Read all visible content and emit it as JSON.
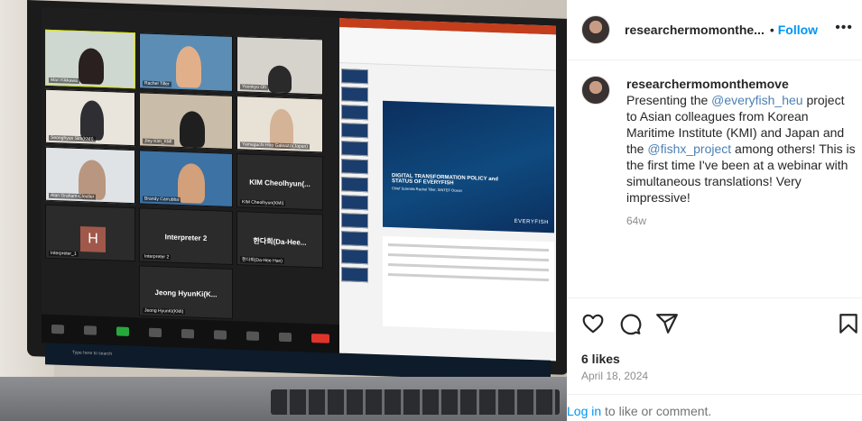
{
  "post": {
    "username": "researchermomonthe...",
    "follow_label": "Follow",
    "follow_separator": "•",
    "more_label": "•••"
  },
  "caption": {
    "username": "researchermomonthemove",
    "text_1": "Presenting the ",
    "mention_1": "@everyfish_heu",
    "text_2": " project to Asian colleagues from Korean Maritime Institute (KMI) and Japan and the ",
    "mention_2": "@fishx_project",
    "text_3": " among others! This is the first time I've been at a webinar with simultaneous translations! Very impressive!",
    "age": "64w"
  },
  "actions": {
    "like_icon": "heart-icon",
    "comment_icon": "comment-icon",
    "share_icon": "share-icon",
    "save_icon": "bookmark-icon"
  },
  "likes": "6 likes",
  "date": "April 18, 2024",
  "login": {
    "link_label": "Log in",
    "rest": " to like or comment."
  },
  "photo": {
    "zoom_tiles": {
      "t1": "Mari Kikkawa",
      "t2": "Rachel Tiller",
      "t3": "Yoonkyo Oh",
      "t4": "Seonghyun Sim(KMI)",
      "t5": "Jiny Kim_KMI",
      "t6": "Yamaguchi Hiro Galeazzi(Japan)",
      "t7": "Alan Graham-Cloutier",
      "t8": "Brandy Carrubba",
      "t9_big": "KIM Cheolhyun(...",
      "t9_small": "KIM Cheolhyun(KMI)",
      "t10_letter": "H",
      "t10_small": "Interpreter_1",
      "t11_big": "Interpreter 2",
      "t11_small": "Interpreter 2",
      "t12_big": "한다희(Da-Hee...",
      "t12_small": "한다희(Da-Hee Han)",
      "t13_big": "Jeong HyunKi(K...",
      "t13_small": "Jeong HyunKi(KMI)"
    },
    "slide_title": "DIGITAL TRANSFORMATION POLICY and STATUS OF EVERYFISH",
    "slide_subtitle": "Chief Scientist Rachel Tiller, SINTEF Ocean",
    "slide_brand": "EVERYFISH",
    "search_placeholder": "Type here to search"
  },
  "colors": {
    "accent": "#0095f6",
    "mention": "#4a7fb5",
    "muted": "#8e8e8e",
    "text": "#262626"
  }
}
